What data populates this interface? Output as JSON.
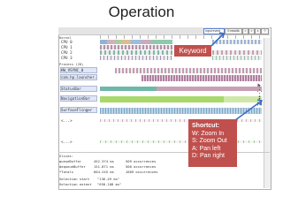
{
  "slide_title": "Operation",
  "toolbar": {
    "search_value": "input event",
    "buttons": [
      "0 results",
      "<",
      ">",
      "x",
      "?"
    ]
  },
  "tree": {
    "kernel_group": "Kernel",
    "cpus": [
      "CPU 0",
      "CPU 1",
      "CPU 2",
      "CPU 3"
    ],
    "process_group": "Process (28)",
    "threads": [
      "HW_VSYNC_0",
      "com.hp.launcher.com.hp.laun...",
      "StatusBar",
      "NavigationBar",
      "SurfaceFlinger",
      "<...>",
      "<...>"
    ]
  },
  "stats": {
    "header": "Slices:",
    "rows": [
      {
        "name": "queueBuffer",
        "value": "452.374 ms",
        "count": "509 occurrences"
      },
      {
        "name": "dequeueBuffer",
        "value": "151.871 ms",
        "count": "500 occurrences"
      },
      {
        "name": "*Totals",
        "value": "604.245 ms",
        "count": "1009 occurrences"
      }
    ],
    "start_label": "Selection start",
    "start_value": "\"136.49 ms\"",
    "extent_label": "Selection extent",
    "extent_value": "\"650.108 ms\""
  },
  "callouts": {
    "keyword": "Keyword",
    "shortcut_title": "Shortcut:",
    "shortcut_lines": [
      "W: Zoom In",
      "S: Zoom Out",
      "A: Pan left",
      "D: Pan right"
    ]
  },
  "colors": {
    "callout_bg": "#c0504d",
    "arrow": "#3e6fc4",
    "lane_green": "#a6d96a",
    "lane_pink": "#c7a0b3",
    "lane_teal": "#6fb7a8"
  },
  "side_icons": [
    "select-icon",
    "pan-icon",
    "zoom-icon",
    "timing-icon"
  ]
}
